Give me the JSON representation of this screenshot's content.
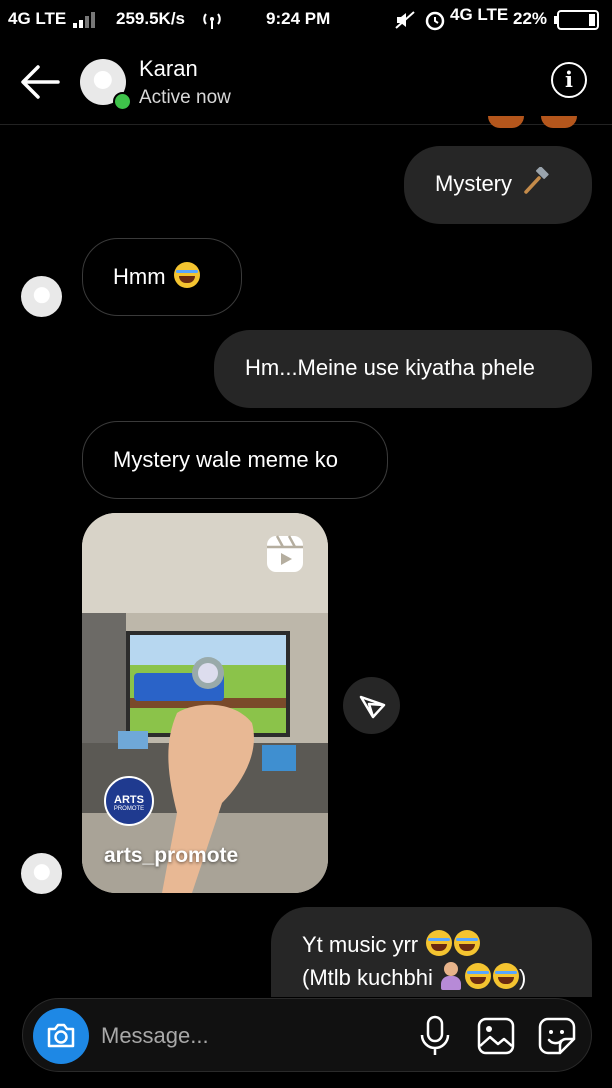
{
  "status_bar": {
    "network_left": "4G LTE",
    "speed": "259.5K/s",
    "time": "9:24 PM",
    "network_right": "4G LTE",
    "battery": "22%"
  },
  "header": {
    "contact_name": "Karan",
    "presence": "Active now"
  },
  "messages": [
    {
      "from": "me",
      "text": "Mystery"
    },
    {
      "from": "them",
      "text": "Hmm"
    },
    {
      "from": "me",
      "text": "Hm...Meine use kiyatha phele"
    },
    {
      "from": "them",
      "text": "Mystery wale meme ko"
    },
    {
      "from": "them",
      "type": "reel",
      "account": "arts_promote",
      "badge_text": "ARTS",
      "badge_subtext": "PROMOTE"
    },
    {
      "from": "me",
      "lines": [
        "Yt music yrr",
        "(Mtlb kuchbhi"
      ]
    }
  ],
  "composer": {
    "placeholder": "Message..."
  },
  "icons": {
    "back": "back-arrow-icon",
    "info": "info-icon",
    "camera": "camera-icon",
    "mic": "microphone-icon",
    "gallery": "gallery-icon",
    "sticker": "sticker-icon",
    "share": "share-icon",
    "reel": "reels-icon"
  },
  "colors": {
    "background": "#000000",
    "outgoing_bubble": "#262626",
    "camera_button": "#1e88e5",
    "online_dot": "#3ec24a"
  }
}
